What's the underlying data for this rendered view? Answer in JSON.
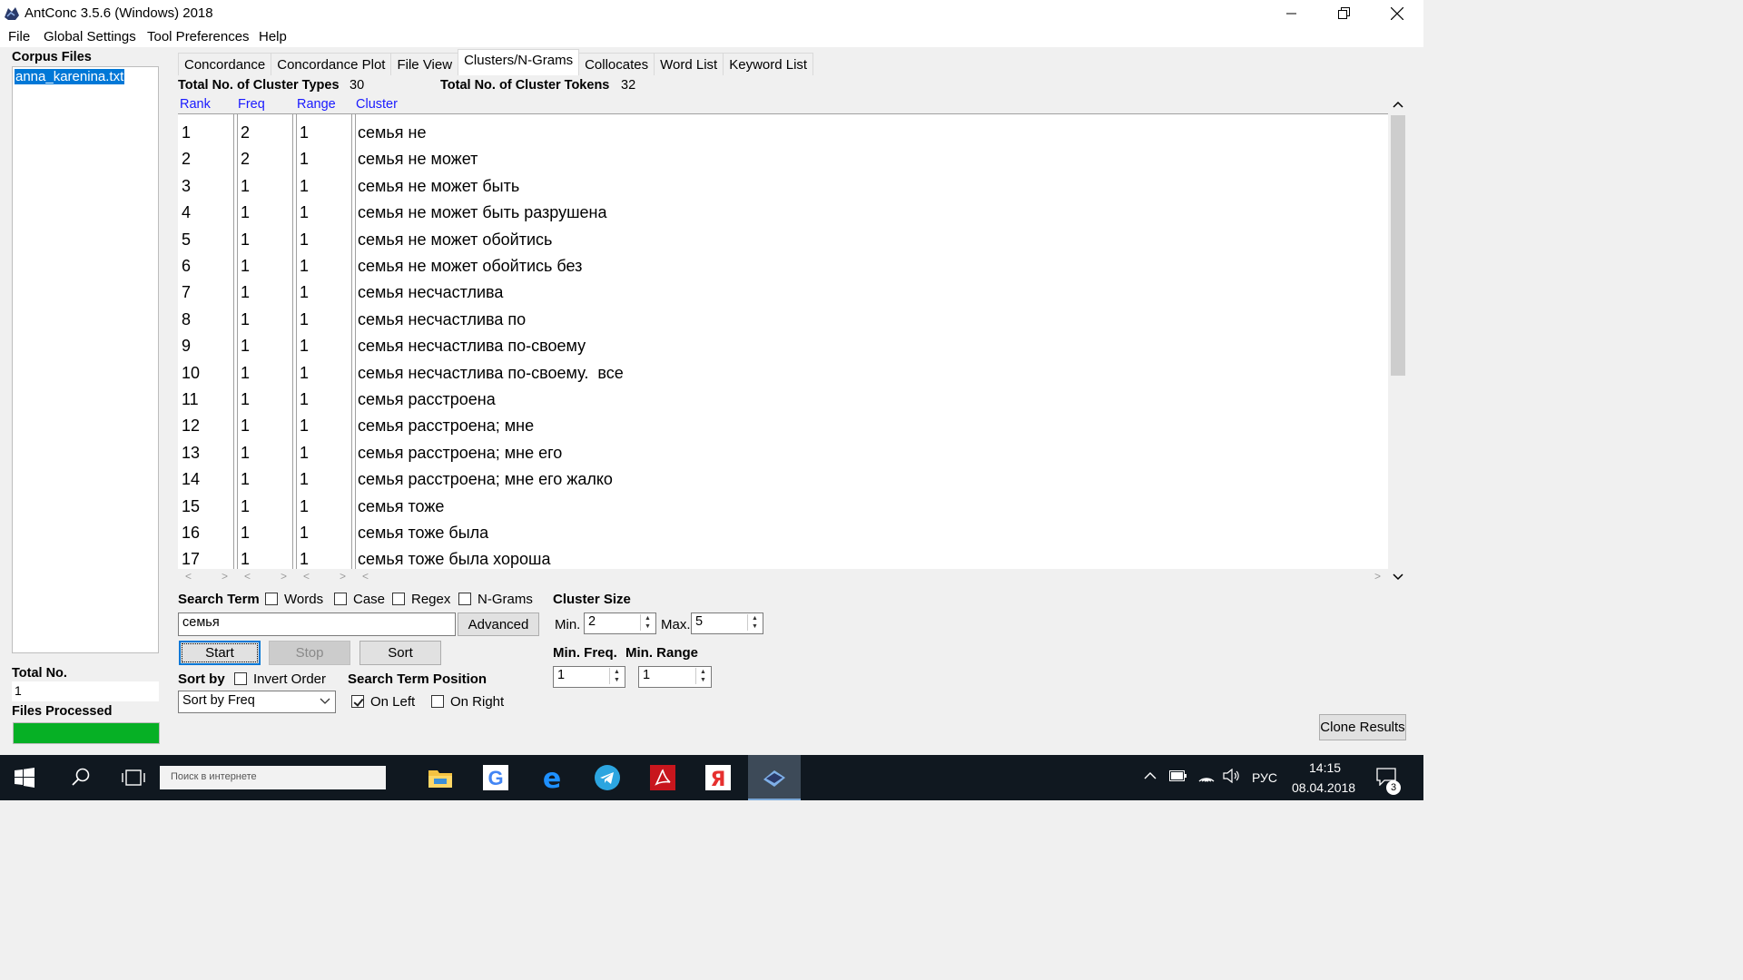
{
  "window": {
    "title": "AntConc 3.5.6 (Windows) 2018"
  },
  "menu": [
    "File",
    "Global Settings",
    "Tool Preferences",
    "Help"
  ],
  "corpus": {
    "header": "Corpus Files",
    "files": [
      "anna_karenina.txt"
    ],
    "total_label": "Total No.",
    "total_value": "1",
    "processed_label": "Files Processed",
    "progress": 1.0
  },
  "tabs": [
    "Concordance",
    "Concordance Plot",
    "File View",
    "Clusters/N-Grams",
    "Collocates",
    "Word List",
    "Keyword List"
  ],
  "active_tab": "Clusters/N-Grams",
  "stats": {
    "types_label": "Total No. of Cluster Types",
    "types_value": "30",
    "tokens_label": "Total No. of Cluster Tokens",
    "tokens_value": "32"
  },
  "table": {
    "headers": [
      "Rank",
      "Freq",
      "Range",
      "Cluster"
    ],
    "rows": [
      [
        "1",
        "2",
        "1",
        "семья не"
      ],
      [
        "2",
        "2",
        "1",
        "семья не может"
      ],
      [
        "3",
        "1",
        "1",
        "семья не может быть"
      ],
      [
        "4",
        "1",
        "1",
        "семья не может быть разрушена"
      ],
      [
        "5",
        "1",
        "1",
        "семья не может обойтись"
      ],
      [
        "6",
        "1",
        "1",
        "семья не может обойтись без"
      ],
      [
        "7",
        "1",
        "1",
        "семья несчастлива"
      ],
      [
        "8",
        "1",
        "1",
        "семья несчастлива по"
      ],
      [
        "9",
        "1",
        "1",
        "семья несчастлива по-своему"
      ],
      [
        "10",
        "1",
        "1",
        "семья несчастлива по-своему.  все"
      ],
      [
        "11",
        "1",
        "1",
        "семья расстроена"
      ],
      [
        "12",
        "1",
        "1",
        "семья расстроена; мне"
      ],
      [
        "13",
        "1",
        "1",
        "семья расстроена; мне его"
      ],
      [
        "14",
        "1",
        "1",
        "семья расстроена; мне его жалко"
      ],
      [
        "15",
        "1",
        "1",
        "семья тоже"
      ],
      [
        "16",
        "1",
        "1",
        "семья тоже была"
      ],
      [
        "17",
        "1",
        "1",
        "семья тоже была хороша"
      ]
    ]
  },
  "search": {
    "label": "Search Term",
    "options": [
      {
        "label": "Words",
        "checked": false
      },
      {
        "label": "Case",
        "checked": false
      },
      {
        "label": "Regex",
        "checked": false
      },
      {
        "label": "N-Grams",
        "checked": false
      }
    ],
    "value": "семья",
    "advanced_label": "Advanced"
  },
  "buttons": {
    "start": "Start",
    "stop": "Stop",
    "sort": "Sort",
    "clone": "Clone Results"
  },
  "sort": {
    "label": "Sort by",
    "invert_label": "Invert Order",
    "invert_checked": false,
    "selected": "Sort by Freq"
  },
  "position": {
    "label": "Search Term Position",
    "on_left_label": "On Left",
    "on_left_checked": true,
    "on_right_label": "On Right",
    "on_right_checked": false
  },
  "cluster_size": {
    "label": "Cluster Size",
    "min_label": "Min.",
    "min_value": "2",
    "max_label": "Max.",
    "max_value": "5"
  },
  "min_freq": {
    "label": "Min. Freq.",
    "value": "1"
  },
  "min_range": {
    "label": "Min. Range",
    "value": "1"
  },
  "taskbar": {
    "search_placeholder": "Поиск в интернете",
    "lang": "РУС",
    "time": "14:15",
    "date": "08.04.2018",
    "notifications": "3"
  },
  "colors": {
    "accent": "#0078d7",
    "header_link": "#1a1aff",
    "progress": "#06b025",
    "taskbar": "#101820"
  }
}
